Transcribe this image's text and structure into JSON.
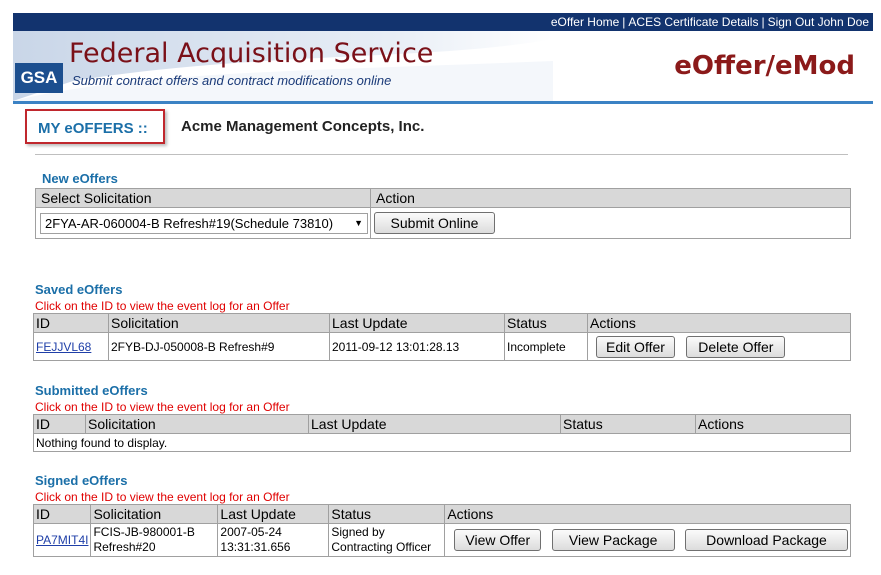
{
  "topnav": {
    "home": "eOffer Home",
    "aces": "ACES Certificate Details",
    "signout": "Sign Out John Doe",
    "sep": "|"
  },
  "banner": {
    "logo": "GSA",
    "title": "Federal Acquisition Service",
    "subtitle": "Submit contract offers and contract modifications online",
    "app": "eOffer/eMod"
  },
  "page": {
    "heading": "MY eOFFERS ::",
    "company": "Acme Management Concepts, Inc."
  },
  "new_offers": {
    "title": "New eOffers",
    "col_select": "Select Solicitation",
    "col_action": "Action",
    "selected": "2FYA-AR-060004-B Refresh#19(Schedule 73810)",
    "submit": "Submit Online"
  },
  "saved": {
    "title": "Saved eOffers",
    "hint": "Click on the ID to view the event log for an Offer",
    "headers": [
      "ID",
      "Solicitation",
      "Last Update",
      "Status",
      "Actions"
    ],
    "row": {
      "id": "FEJJVL68",
      "solicitation": "2FYB-DJ-050008-B Refresh#9",
      "last_update": "2011-09-12 13:01:28.13",
      "status": "Incomplete",
      "edit": "Edit Offer",
      "delete": "Delete Offer"
    }
  },
  "submitted": {
    "title": "Submitted eOffers",
    "hint": "Click on the ID to view the event log for an Offer",
    "headers": [
      "ID",
      "Solicitation",
      "Last Update",
      "Status",
      "Actions"
    ],
    "empty": "Nothing found to display."
  },
  "signed": {
    "title": "Signed eOffers",
    "hint": "Click on the ID to view the event log for an Offer",
    "headers": [
      "ID",
      "Solicitation",
      "Last Update",
      "Status",
      "Actions"
    ],
    "row": {
      "id": "PA7MIT4I",
      "solicitation_1": "FCIS-JB-980001-B",
      "solicitation_2": "Refresh#20",
      "last_update_1": "2007-05-24",
      "last_update_2": "13:31:31.656",
      "status_1": "Signed by",
      "status_2": "Contracting Officer",
      "view_offer": "View Offer",
      "view_package": "View Package",
      "download_package": "Download Package"
    }
  },
  "colors": {
    "topbar": "#12336e",
    "accent": "#1b6fa8",
    "brand_red": "#8b1a1a",
    "hint_red": "#e00000"
  }
}
